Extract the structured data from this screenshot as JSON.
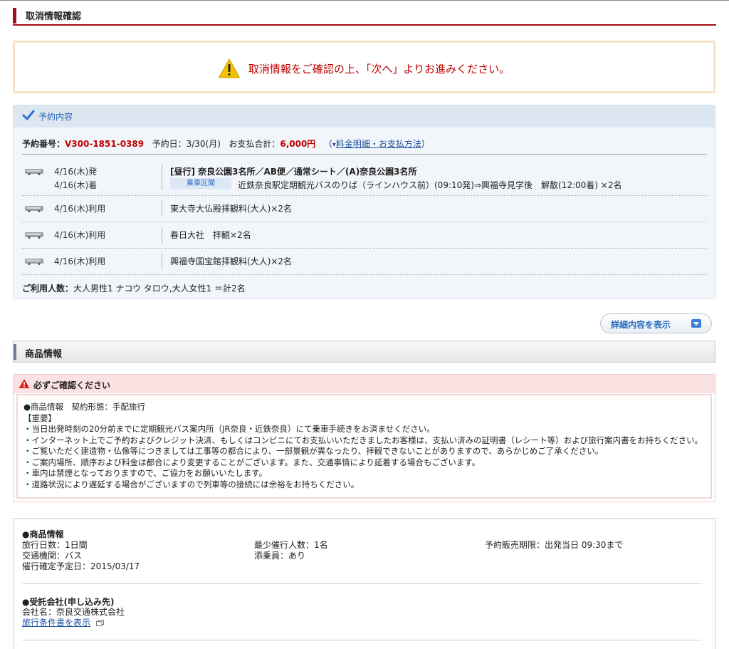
{
  "page": {
    "title": "取消情報確認"
  },
  "notice": {
    "message": "取消情報をご確認の上、「次へ」よりお進みください。"
  },
  "reservation": {
    "section_title": "予約内容",
    "number_label": "予約番号：",
    "number": "V300-1851-0389",
    "date_text": "予約日：3/30(月)",
    "total_label": "お支払合計：",
    "total": "6,000円",
    "paren_open": "（",
    "link_arrow": "▾",
    "link": "料金明細・お支払方法",
    "paren_close": "）",
    "items": [
      {
        "date1": "4/16(木)発",
        "date2": "4/16(木)着",
        "title": "[昼行] 奈良公園3名所／AB便／通常シート／(A)奈良公園3名所",
        "tag": "乗車区間",
        "detail": "近鉄奈良駅定期観光バスのりば（ラインハウス前）(09:10発)⇒興福寺見学後　解散(12:00着) ×2名"
      },
      {
        "date1": "4/16(木)利用",
        "title": "東大寺大仏殿拝観料(大人)×2名"
      },
      {
        "date1": "4/16(木)利用",
        "title": "春日大社　拝観×2名"
      },
      {
        "date1": "4/16(木)利用",
        "title": "興福寺国宝館拝観料(大人)×2名"
      }
    ],
    "usage_label": "ご利用人数：",
    "usage": "大人男性1 ナコウ タロウ,大人女性1 ＝計2名"
  },
  "detail_button": {
    "label": "詳細内容を表示"
  },
  "product_section": {
    "title": "商品情報"
  },
  "warning": {
    "title": "必ずご確認ください",
    "lines": [
      "●商品情報　契約形態：手配旅行",
      "【重要】",
      "・当日出発時刻の20分前までに定期観光バス案内所（JR奈良・近鉄奈良）にて乗車手続きをお済ませください。",
      "・インターネット上でご予約およびクレジット決済、もしくはコンビニにてお支払いいただきましたお客様は、支払い済みの証明書（レシート等）および旅行案内書をお持ちください。",
      "・ご覧いただく建造物・仏像等につきましては工事等の都合により、一部景観が異なったり、拝観できないことがありますので、あらかじめご了承ください。",
      "・ご案内場所、順序および料金は都合により変更することがございます。また、交通事情により延着する場合もございます。",
      "・車内は禁煙となっておりますので、ご協力をお願いいたします。",
      "・道路状況により遅延する場合がございますので列車等の接続には余裕をお持ちください。"
    ]
  },
  "product_info": {
    "heading": "●商品情報",
    "col1": [
      "旅行日数：1日間",
      "交通機関：バス",
      "催行確定予定日：2015/03/17"
    ],
    "col2": [
      "最少催行人数：1名",
      "添乗員：あり"
    ],
    "col3": [
      "予約販売期限：出発当日 09:30まで"
    ],
    "company_heading": "●受託会社(申し込み先)",
    "company": "会社名：奈良交通株式会社",
    "conditions_link": "旅行条件書を表示"
  }
}
